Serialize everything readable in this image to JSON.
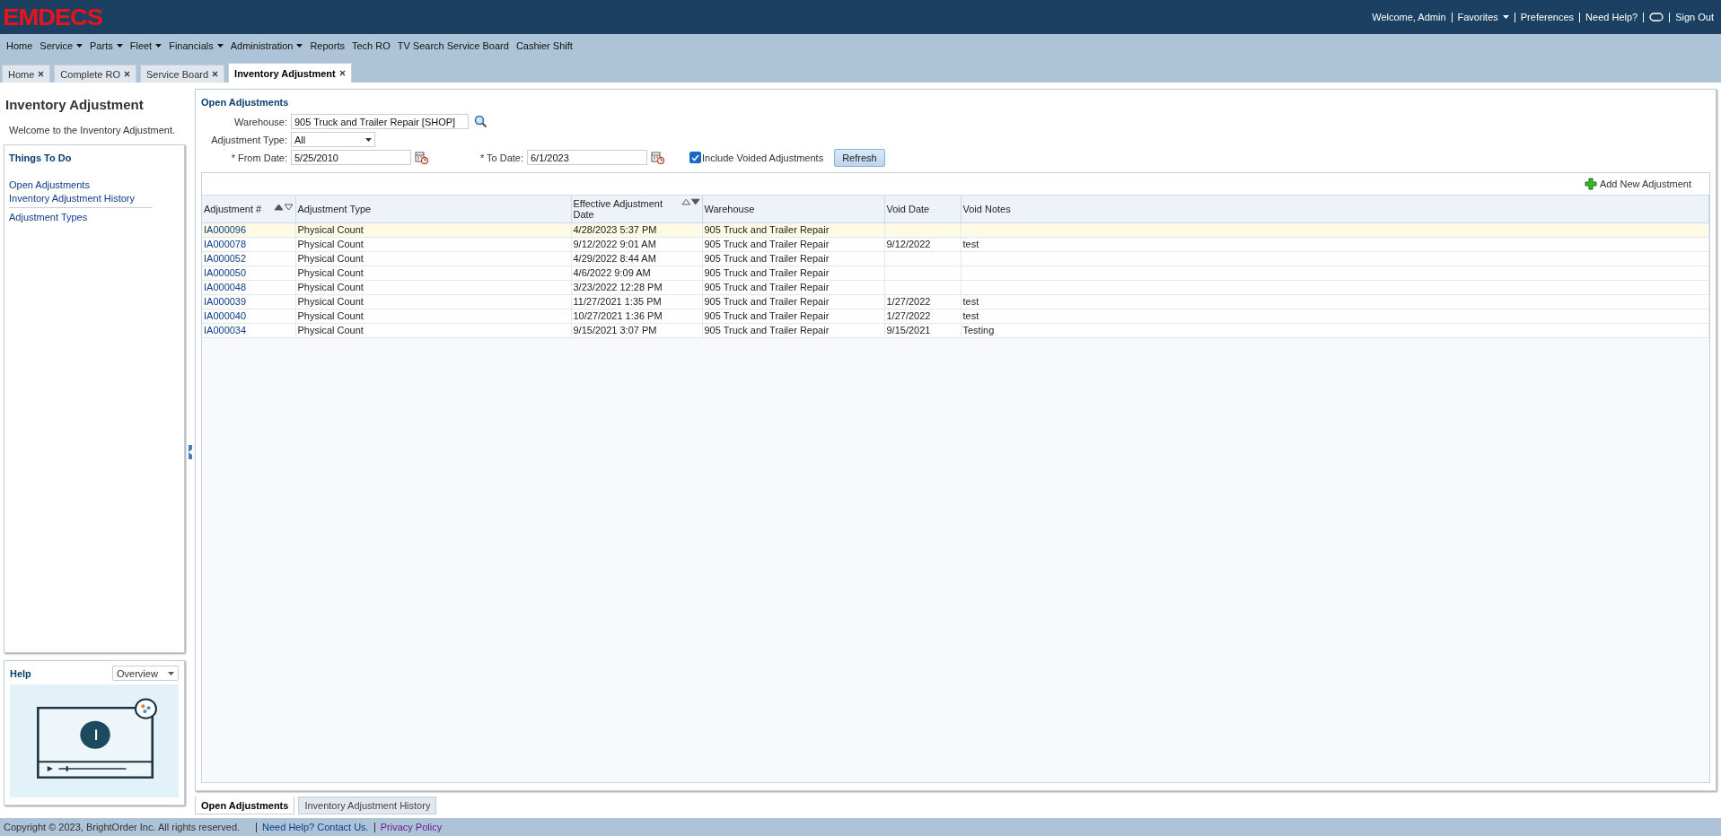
{
  "header": {
    "logo": "EMDECS",
    "links": [
      {
        "label": "Welcome, Admin",
        "kind": "text"
      },
      {
        "label": "Favorites",
        "kind": "menu"
      },
      {
        "label": "Preferences",
        "kind": "link"
      },
      {
        "label": "Need Help?",
        "kind": "link"
      },
      {
        "kind": "chat"
      },
      {
        "label": "Sign Out",
        "kind": "link"
      }
    ]
  },
  "menu": [
    {
      "label": "Home",
      "has_menu": false
    },
    {
      "label": "Service",
      "has_menu": true
    },
    {
      "label": "Parts",
      "has_menu": true
    },
    {
      "label": "Fleet",
      "has_menu": true
    },
    {
      "label": "Financials",
      "has_menu": true
    },
    {
      "label": "Administration",
      "has_menu": true
    },
    {
      "label": "Reports",
      "has_menu": false
    },
    {
      "label": "Tech RO",
      "has_menu": false
    },
    {
      "label": "TV Search Service Board",
      "has_menu": false
    },
    {
      "label": "Cashier Shift",
      "has_menu": false
    }
  ],
  "tabs": [
    {
      "label": "Home",
      "selected": false
    },
    {
      "label": "Complete RO",
      "selected": false
    },
    {
      "label": "Service Board",
      "selected": false
    },
    {
      "label": "Inventory Adjustment",
      "selected": true
    }
  ],
  "sidebar": {
    "title": "Inventory Adjustment",
    "welcome": "Welcome to the Inventory Adjustment.",
    "things_to_do": {
      "title": "Things To Do",
      "groups": [
        [
          "Open Adjustments",
          "Inventory Adjustment History"
        ],
        [
          "Adjustment Types"
        ]
      ]
    },
    "help": {
      "title": "Help",
      "select": "Overview"
    }
  },
  "form": {
    "title": "Open Adjustments",
    "warehouse": {
      "label": "Warehouse:",
      "value": "905 Truck and Trailer Repair [SHOP]"
    },
    "adjustment_type": {
      "label": "Adjustment Type:",
      "value": "All"
    },
    "from_date": {
      "label": "* From Date:",
      "value": "5/25/2010"
    },
    "to_date": {
      "label": "* To Date:",
      "value": "6/1/2023"
    },
    "include_voided": {
      "label": "Include Voided Adjustments",
      "checked": true
    },
    "refresh": "Refresh"
  },
  "table": {
    "add_button": "Add New Adjustment",
    "columns": [
      {
        "label": "Adjustment #",
        "ascending": true
      },
      {
        "label": "Adjustment Type"
      },
      {
        "label": "Effective Adjustment Date",
        "ascending": false
      },
      {
        "label": "Warehouse"
      },
      {
        "label": "Void Date"
      },
      {
        "label": "Void Notes"
      }
    ],
    "rows": [
      {
        "selected": true,
        "cells": [
          "IA000096",
          "Physical Count",
          "4/28/2023 5:37 PM",
          "905 Truck and Trailer Repair",
          "",
          ""
        ]
      },
      {
        "selected": false,
        "cells": [
          "IA000078",
          "Physical Count",
          "9/12/2022 9:01 AM",
          "905 Truck and Trailer Repair",
          "9/12/2022",
          "test"
        ]
      },
      {
        "selected": false,
        "cells": [
          "IA000052",
          "Physical Count",
          "4/29/2022 8:44 AM",
          "905 Truck and Trailer Repair",
          "",
          ""
        ]
      },
      {
        "selected": false,
        "cells": [
          "IA000050",
          "Physical Count",
          "4/6/2022 9:09 AM",
          "905 Truck and Trailer Repair",
          "",
          ""
        ]
      },
      {
        "selected": false,
        "cells": [
          "IA000048",
          "Physical Count",
          "3/23/2022 12:28 PM",
          "905 Truck and Trailer Repair",
          "",
          ""
        ]
      },
      {
        "selected": false,
        "cells": [
          "IA000039",
          "Physical Count",
          "11/27/2021 1:35 PM",
          "905 Truck and Trailer Repair",
          "1/27/2022",
          "test"
        ]
      },
      {
        "selected": false,
        "cells": [
          "IA000040",
          "Physical Count",
          "10/27/2021 1:36 PM",
          "905 Truck and Trailer Repair",
          "1/27/2022",
          "test"
        ]
      },
      {
        "selected": false,
        "cells": [
          "IA000034",
          "Physical Count",
          "9/15/2021 3:07 PM",
          "905 Truck and Trailer Repair",
          "9/15/2021",
          "Testing"
        ]
      }
    ]
  },
  "bottom_tabs": [
    {
      "label": "Open Adjustments",
      "selected": true
    },
    {
      "label": "Inventory Adjustment History",
      "selected": false
    }
  ],
  "footer": {
    "copyright": "Copyright © 2023, BrightOrder Inc. All rights reserved.",
    "links": [
      {
        "label": "Need Help? Contact Us.",
        "visited": false
      },
      {
        "label": "Privacy Policy",
        "visited": true
      }
    ]
  }
}
